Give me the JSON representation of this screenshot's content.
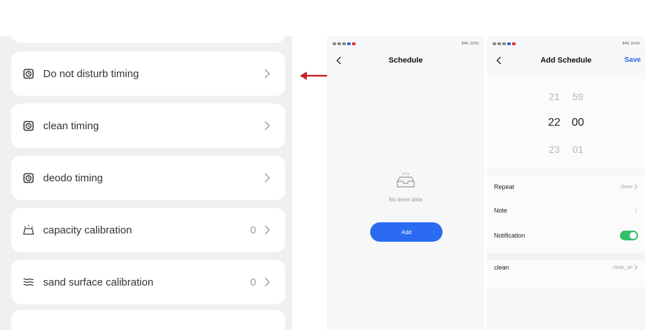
{
  "settings_list": {
    "items": [
      {
        "label": "Do not disturb timing",
        "icon": "alarm-clock-icon",
        "count": ""
      },
      {
        "label": "clean timing",
        "icon": "alarm-clock-icon",
        "count": ""
      },
      {
        "label": "deodo timing",
        "icon": "alarm-clock-icon",
        "count": ""
      },
      {
        "label": "capacity calibration",
        "icon": "bell-tray-icon",
        "count": "0"
      },
      {
        "label": "sand surface calibration",
        "icon": "waves-icon",
        "count": "0"
      }
    ]
  },
  "phone_left": {
    "status_time": "10:53",
    "status_battery": "84%",
    "title": "Schedule",
    "empty_text": "No timer data",
    "add_label": "Add"
  },
  "phone_right": {
    "status_time": "10:54",
    "status_battery": "84%",
    "title": "Add Schedule",
    "save_label": "Save",
    "picker": {
      "above": {
        "hour": "21",
        "minute": "59"
      },
      "selected": {
        "hour": "22",
        "minute": "00"
      },
      "below": {
        "hour": "23",
        "minute": "01"
      }
    },
    "rows": {
      "repeat_label": "Repeat",
      "repeat_value": "Once",
      "note_label": "Note",
      "notification_label": "Notification",
      "notification_on": true,
      "action_label": "clean",
      "action_value": "clean_on"
    }
  },
  "colors": {
    "accent_blue": "#2a6bf2",
    "toggle_green": "#34c066",
    "arrow_red": "#c8202a"
  }
}
